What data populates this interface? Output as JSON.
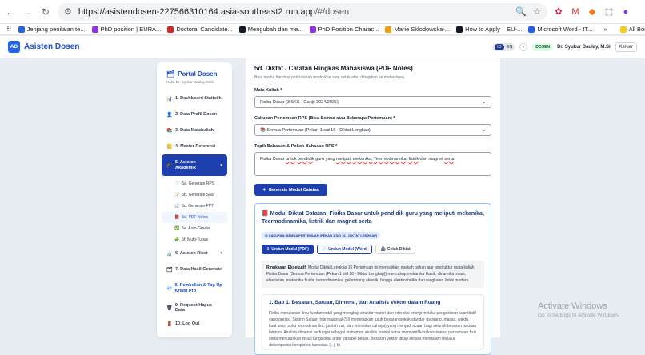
{
  "browser": {
    "url_domain": "https://asistendosen-227566310164.asia-southeast2.run.app",
    "url_path": "/#/dosen",
    "bookmarks": [
      "Jenjang penilaian te...",
      "PhD position | EURA...",
      "Doctoral Candidate...",
      "Mengubah dan me...",
      "PhD Position Charac...",
      "Marie Sklodowska-...",
      "How to Apply – EU-...",
      "Microsoft Word - IT..."
    ],
    "all_bookmarks": "All Book"
  },
  "app": {
    "logo": "AD",
    "title": "Asisten Dosen",
    "lang_id": "ID",
    "lang_en": "EN",
    "role": "DOSEN",
    "user": "Dr. Syukur Daulay, M.Si",
    "logout": "Keluar"
  },
  "sidebar": {
    "title": "Portal Dosen",
    "hello": "Halo, Dr. Syukur Daulay, M.Si",
    "items_top": [
      {
        "label": "1. Dashboard Statistik",
        "icon": "📊"
      },
      {
        "label": "2. Data Profil Dosen",
        "icon": "👤"
      },
      {
        "label": "3. Data Matakuliah",
        "icon": "📚"
      },
      {
        "label": "4. Master Referensi",
        "icon": "📒"
      }
    ],
    "active": {
      "label": "5. Asisten Akademik",
      "icon": "🎓"
    },
    "subs": [
      {
        "label": "5a. Generate RPS",
        "icon": "📄"
      },
      {
        "label": "5b. Generate Soal",
        "icon": "📝"
      },
      {
        "label": "5c. Generate PPT",
        "icon": "📊"
      },
      {
        "label": "5d. PDF Notes",
        "icon": "📕"
      },
      {
        "label": "5e. Auto-Grader",
        "icon": "✅"
      },
      {
        "label": "5f. Multi-Tugas",
        "icon": "🧩"
      }
    ],
    "items_bottom": [
      {
        "label": "6. Asisten Riset",
        "icon": "🔬"
      },
      {
        "label": "7. Data Hasil Generate",
        "icon": "🗂"
      },
      {
        "label": "8. Pembelian & Top Up Kredit Pro",
        "icon": "💎"
      },
      {
        "label": "9. Request Hapus Data",
        "icon": "🗑"
      },
      {
        "label": "10. Log Out",
        "icon": "🚪"
      }
    ]
  },
  "main": {
    "title": "5d. Diktat / Catatan Ringkas Mahasiswa (PDF Notes)",
    "desc": "Buat modul handout perkuliahan terstruktur siap cetak atau dibagikan ke mahasiswa.",
    "course_label": "Mata Kuliah *",
    "course_value": "Fisika Dasar (3 SKS - Ganjil 2024/2025)",
    "coverage_label": "Cakupan Pertemuan RPS (Bisa Semua atau Beberapa Pertemuan) *",
    "coverage_value": "Semua Pertemuan (Pekan 1 s/d 16 - Diktat Lengkap)",
    "topic_label": "Topik Bahasan & Pokok Bahasan RPS *",
    "topic_words": [
      "Fisika",
      "Dasar",
      "untuk",
      "pendidik",
      "guru",
      "yang",
      "meliputi",
      "mekanika,",
      "Teermodinamika,",
      "listrik",
      "dan",
      "magnet",
      "serta"
    ],
    "generate": "Generate Modul Catatan"
  },
  "result": {
    "title": "Modul Diktat Catatan: Fisika Dasar untuk pendidik guru yang meliputi mekanika, Teermodinamika, listrik dan magnet serta",
    "scope": "CAKUPAN: SEMUA PERTEMUAN (PEKAN 1 S/D 16 - DIKTAT LENGKAP)",
    "btn_pdf": "Unduh Modul (PDF)",
    "btn_word": "Unduh Modul (Word)",
    "btn_print": "Cetak Diktat",
    "summary_label": "Ringkasan Eksekutif:",
    "summary_text": "Modul Diktat Lengkap 16 Pertemuan ini menyajikan naskah bahan ajar terstruktur mata kuliah Fisika Dasar (Semua Pertemuan (Pekan 1 s/d 16 - Diktat Lengkap)) mencakup mekanika klasik, dinamika rotasi, elastisitas, mekanika fluida, termodinamika, gelombang akustik, hingga elektrostatika dan rangkaian listrik modern.",
    "chapter_title": "1. Bab 1. Besaran, Satuan, Dimensi, dan Analisis Vektor dalam Ruang",
    "chapter_text": "Fisika merupakan ilmu fundamental yang mengkaji struktur materi dan interaksi energi melalui pengukuran kuantitatif yang presisi. Sistem Satuan Internasional (SI) menetapkan tujuh besaran pokok standar (panjang, massa, waktu, kuat arus, suhu termodinamika, jumlah zat, dan intensitas cahaya) yang menjadi acuan bagi seluruh besaran turunan lainnya. Analisis dimensi berfungsi sebagai instrumen analitis krusial untuk memverifikasi konsistensi persamaan fisis serta menurunkan relasi fungsional antar variabel bebas. Besaran vektor dikaji secara mendalam melalui dekomposisi komponen kartesius (i, j, k)"
  },
  "os": {
    "activate": "Activate Windows",
    "goto": "Go to Settings to activate Windows."
  }
}
